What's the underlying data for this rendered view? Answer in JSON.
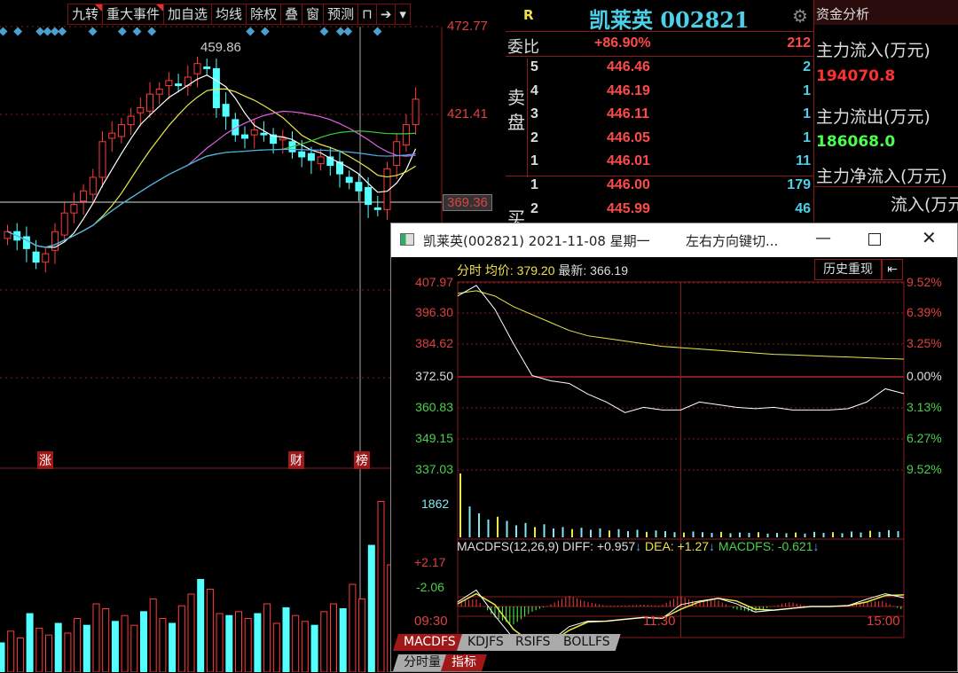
{
  "toolbar": {
    "items": [
      "九转",
      "重大事件",
      "加自选",
      "均线",
      "除权",
      "叠",
      "窗",
      "预测"
    ]
  },
  "kline": {
    "price_labels": [
      "472.77",
      "421.41",
      "369.36"
    ],
    "max_label": "459.86",
    "markers": [
      "涨",
      "财",
      "榜"
    ]
  },
  "orderbook": {
    "header_flag": "R",
    "title": "凯莱英 002821",
    "ratio_label": "委比",
    "ratio_value": "+86.90%",
    "ratio_diff": "212",
    "sell_label": "卖盘",
    "buy_label": "买",
    "sell": [
      {
        "level": "5",
        "price": "446.46",
        "vol": "2"
      },
      {
        "level": "4",
        "price": "446.19",
        "vol": "1"
      },
      {
        "level": "3",
        "price": "446.11",
        "vol": "1"
      },
      {
        "level": "2",
        "price": "446.05",
        "vol": "1"
      },
      {
        "level": "1",
        "price": "446.01",
        "vol": "11"
      }
    ],
    "buy": [
      {
        "level": "1",
        "price": "446.00",
        "vol": "179"
      },
      {
        "level": "2",
        "price": "445.99",
        "vol": "46"
      }
    ]
  },
  "fund": {
    "title": "资金分析",
    "in_label": "主力流入(万元)",
    "in_value": "194070.8",
    "out_label": "主力流出(万元)",
    "out_value": "186068.0",
    "net_label": "主力净流入(万元)",
    "partial": "流入(万元"
  },
  "popup": {
    "title": "凯莱英(002821) 2021-11-08 星期一",
    "hint": "左右方向键切...",
    "info_prefix": "分时",
    "avg_label": "均价:",
    "avg_value": "379.20",
    "last_label": "最新:",
    "last_value": "366.19",
    "history_button": "历史重现",
    "left_axis": [
      "407.97",
      "396.30",
      "384.62",
      "372.50",
      "360.83",
      "349.15",
      "337.03"
    ],
    "right_axis": [
      "9.52%",
      "6.39%",
      "3.25%",
      "0.00%",
      "3.13%",
      "6.27%",
      "9.52%"
    ],
    "volume_label": "1862",
    "macd_title": "MACDFS(12,26,9)",
    "diff": "DIFF: +0.957",
    "dea": "DEA: +1.27",
    "macdfs": "MACDFS: -0.621",
    "macd_hi": "+2.17",
    "macd_lo": "-2.06",
    "times": [
      "09:30",
      "11:30",
      "15:00"
    ],
    "tabs": [
      "MACDFS",
      "KDJFS",
      "RSIFS",
      "BOLLFS"
    ],
    "subtabs": [
      "分时量",
      "指标"
    ]
  },
  "colors": {
    "up": "#ff3b3b",
    "down": "#54ffff",
    "grid": "#8a1a1a",
    "avg": "#e8e84a"
  },
  "chart_data": {
    "kline": {
      "type": "candlestick",
      "closes": [
        352,
        347,
        342,
        334,
        339,
        352,
        363,
        368,
        376,
        384,
        405,
        410,
        415,
        420,
        425,
        433,
        436,
        441,
        438,
        443,
        451,
        448,
        425,
        420,
        409,
        407,
        412,
        409,
        404,
        407,
        399,
        396,
        394,
        396,
        391,
        386,
        381,
        376,
        368,
        365,
        389,
        405,
        415,
        430
      ],
      "ylim": [
        327,
        472.77
      ]
    },
    "kvolume": [
      30,
      42,
      35,
      60,
      45,
      38,
      50,
      40,
      55,
      48,
      70,
      65,
      52,
      58,
      48,
      62,
      75,
      55,
      50,
      68,
      80,
      95,
      85,
      60,
      58,
      62,
      55,
      60,
      70,
      50,
      66,
      58,
      52,
      48,
      62,
      70,
      65,
      90,
      75,
      130,
      175,
      110,
      95,
      100
    ],
    "intraday": {
      "type": "line",
      "base": 372.5,
      "minutes": [
        0,
        10,
        20,
        30,
        40,
        50,
        60,
        70,
        80,
        90,
        100,
        110,
        120,
        130,
        140,
        150,
        160,
        170,
        180,
        190,
        200,
        210,
        220,
        230,
        240
      ],
      "price": [
        403,
        407,
        398,
        385,
        373,
        371,
        370,
        366,
        363,
        359,
        361,
        360,
        360,
        363,
        362,
        361,
        360.5,
        361,
        360,
        360,
        360,
        360.5,
        363,
        368,
        366.19
      ],
      "avg": [
        404,
        405,
        403,
        399,
        396,
        393,
        390,
        388,
        387,
        386,
        385,
        384,
        383.5,
        383,
        382.5,
        382,
        381.5,
        381,
        380.8,
        380.5,
        380.2,
        380,
        379.7,
        379.4,
        379.2
      ],
      "ylim": [
        337.03,
        407.97
      ]
    },
    "intraday_volume": [
      1862,
      900,
      700,
      520,
      600,
      480,
      350,
      420,
      300,
      380,
      260,
      300,
      240,
      280,
      220,
      260,
      200,
      240,
      180,
      220,
      160,
      200,
      180,
      150,
      140,
      170,
      150,
      130,
      160,
      120,
      140,
      130,
      150,
      110,
      130,
      120,
      140,
      110,
      160,
      130,
      150,
      120,
      170,
      140,
      190,
      160,
      210,
      180
    ],
    "macd": {
      "diff": [
        0.5,
        1.8,
        -1.0,
        -3.5,
        -4.3,
        -3.8,
        -2.2,
        -1.6,
        -1.6,
        -1.4,
        -1.2,
        -1.3,
        0.2,
        0.6,
        0.9,
        0.3,
        -0.6,
        -0.4,
        -0.2,
        0.0,
        0.0,
        0.1,
        0.8,
        1.4,
        0.96
      ],
      "dea": [
        0.3,
        1.4,
        0.2,
        -2.5,
        -4.0,
        -3.9,
        -2.6,
        -1.7,
        -1.6,
        -1.4,
        -1.2,
        -1.3,
        -0.3,
        0.5,
        0.9,
        0.6,
        -0.3,
        -0.4,
        -0.2,
        0.0,
        0.0,
        0.1,
        0.5,
        1.2,
        1.27
      ],
      "hist": [
        0.6,
        0.8,
        -1.2,
        -2.0,
        -0.6,
        0.2,
        1.2,
        0.5,
        0.1,
        0.1,
        0.2,
        0.1,
        1.2,
        0.4,
        0.8,
        -0.3,
        -0.6,
        0.0,
        0.5,
        0.0,
        0.1,
        0.1,
        0.5,
        0.6,
        -0.3
      ],
      "ylim": [
        -4.6,
        2.6
      ]
    }
  }
}
